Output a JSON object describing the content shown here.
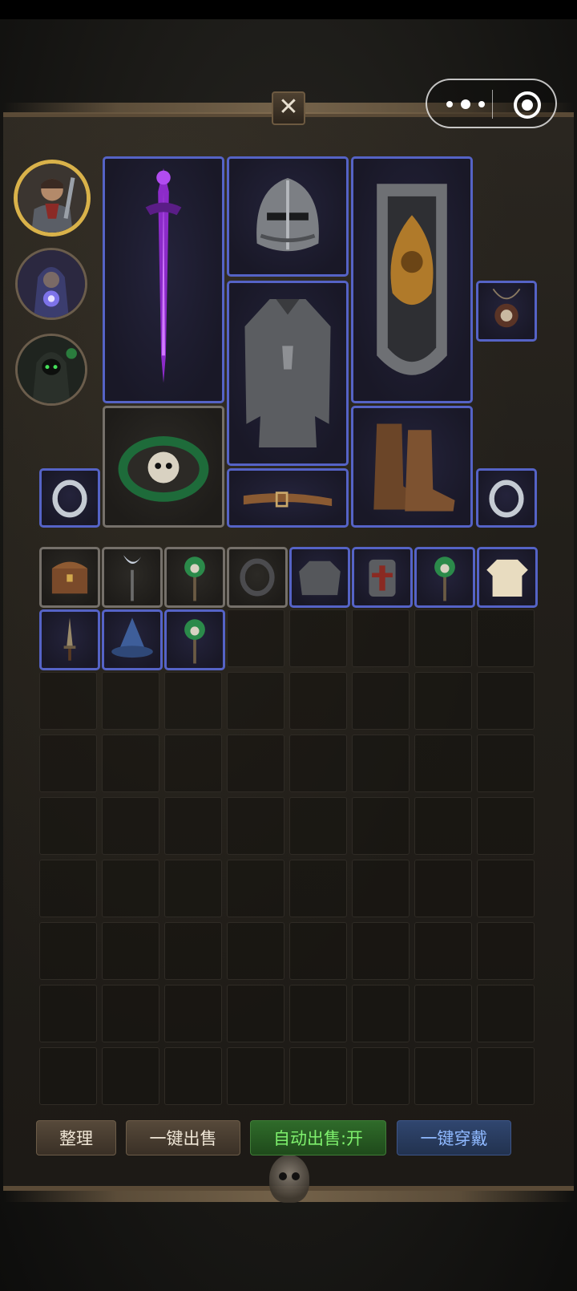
{
  "header": {
    "close_glyph": "✕",
    "capsule": {
      "more_icon": "more-dots-icon",
      "target_icon": "target-circle-icon"
    }
  },
  "heroes": [
    {
      "name": "warrior",
      "icon": "warrior-portrait-icon",
      "active": true
    },
    {
      "name": "mage",
      "icon": "mage-portrait-icon",
      "active": false
    },
    {
      "name": "necromancer",
      "icon": "necromancer-portrait-icon",
      "active": false
    }
  ],
  "equipment": {
    "weapon": "purple-sword-icon",
    "helmet": "steel-helmet-icon",
    "shield": "ornate-tower-shield-icon",
    "amulet": "skull-amulet-icon",
    "armor": "chainmail-armor-icon",
    "bracer": "green-skull-bracer-icon",
    "belt": "leather-belt-icon",
    "boots": "leather-boots-icon",
    "ring_left": "silver-ring-icon",
    "ring_right": "silver-ring-icon"
  },
  "inventory": {
    "rows": 9,
    "cols": 8,
    "items": [
      {
        "icon": "treasure-chest-icon",
        "rarity": "common"
      },
      {
        "icon": "crescent-staff-icon",
        "rarity": "common"
      },
      {
        "icon": "green-skull-scepter-icon",
        "rarity": "common"
      },
      {
        "icon": "dark-ring-icon",
        "rarity": "common"
      },
      {
        "icon": "chainmail-shirt-icon",
        "rarity": "magic"
      },
      {
        "icon": "crusader-helm-icon",
        "rarity": "magic"
      },
      {
        "icon": "green-skull-scepter-icon",
        "rarity": "magic"
      },
      {
        "icon": "cloth-tunic-icon",
        "rarity": "magic"
      },
      {
        "icon": "dagger-icon",
        "rarity": "magic"
      },
      {
        "icon": "wizard-hat-icon",
        "rarity": "magic"
      },
      {
        "icon": "green-skull-scepter-icon",
        "rarity": "magic"
      }
    ]
  },
  "actions": {
    "sort_label": "整理",
    "sell_all_label": "一键出售",
    "auto_sell_label": "自动出售:开",
    "equip_all_label": "一键穿戴"
  },
  "colors": {
    "magic_border": "#5563c6",
    "common_border": "#75706a",
    "active_portrait": "#d9b24a"
  }
}
